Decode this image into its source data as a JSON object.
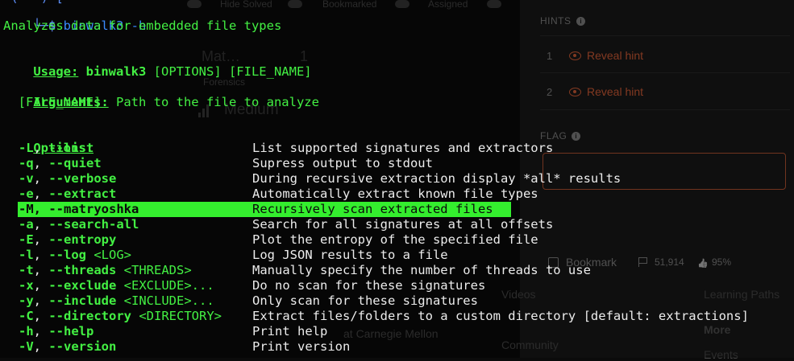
{
  "background_page": {
    "filters": [
      "Hide Solved",
      "Bookmarked",
      "Assigned"
    ],
    "challenge": {
      "title_partial": "Mat…",
      "title_tail": "1",
      "category": "Forensics",
      "difficulty": "Medium"
    },
    "hints_label": "HINTS",
    "hints": [
      {
        "num": "1",
        "label": "Reveal hint"
      },
      {
        "num": "2",
        "label": "Reveal hint"
      }
    ],
    "flag_label": "FLAG",
    "bookmark_label": "Bookmark",
    "solves": "51,914",
    "rating": "95%",
    "footer": [
      "Videos",
      "Community",
      "at Carnegie Mellon",
      "Learning Paths",
      "More",
      "Events"
    ]
  },
  "terminal": {
    "prompt_corner": "└─",
    "prompt_dollar": "$",
    "command": " binwalk3 -h",
    "description": "Analyzes data for embedded file types",
    "usage_label": "Usage:",
    "usage_prog": " binwalk3",
    "usage_args": " [OPTIONS] [FILE_NAME]",
    "arguments_label": "Arguments:",
    "arguments": [
      {
        "name": "  [FILE_NAME]",
        "desc": "  Path to the file to analyze"
      }
    ],
    "options_label": "Options:",
    "options": [
      {
        "short": "-L",
        "long": "--list",
        "arg": "",
        "desc": "List supported signatures and extractors"
      },
      {
        "short": "-q",
        "long": "--quiet",
        "arg": "",
        "desc": "Supress output to stdout"
      },
      {
        "short": "-v",
        "long": "--verbose",
        "arg": "",
        "desc": "During recursive extraction display *all* results"
      },
      {
        "short": "-e",
        "long": "--extract",
        "arg": "",
        "desc": "Automatically extract known file types"
      },
      {
        "short": "-M",
        "long": "--matryoshka",
        "arg": "",
        "desc": "Recursively scan extracted files"
      },
      {
        "short": "-a",
        "long": "--search-all",
        "arg": "",
        "desc": "Search for all signatures at all offsets"
      },
      {
        "short": "-E",
        "long": "--entropy",
        "arg": "",
        "desc": "Plot the entropy of the specified file"
      },
      {
        "short": "-l",
        "long": "--log",
        "arg": " <LOG>",
        "desc": "Log JSON results to a file"
      },
      {
        "short": "-t",
        "long": "--threads",
        "arg": " <THREADS>",
        "desc": "Manually specify the number of threads to use"
      },
      {
        "short": "-x",
        "long": "--exclude",
        "arg": " <EXCLUDE>...",
        "desc": "Do no scan for these signatures"
      },
      {
        "short": "-y",
        "long": "--include",
        "arg": " <INCLUDE>...",
        "desc": "Only scan for these signatures"
      },
      {
        "short": "-C",
        "long": "--directory",
        "arg": " <DIRECTORY>",
        "desc": "Extract files/folders to a custom directory [default: extractions]"
      },
      {
        "short": "-h",
        "long": "--help",
        "arg": "",
        "desc": "Print help"
      },
      {
        "short": "-V",
        "long": "--version",
        "arg": "",
        "desc": "Print version"
      }
    ],
    "highlighted_option_index": 4,
    "colors": {
      "green": "#43f043",
      "blue": "#5c8df6",
      "highlight": "#34ee2e",
      "text": "#ececec"
    }
  }
}
